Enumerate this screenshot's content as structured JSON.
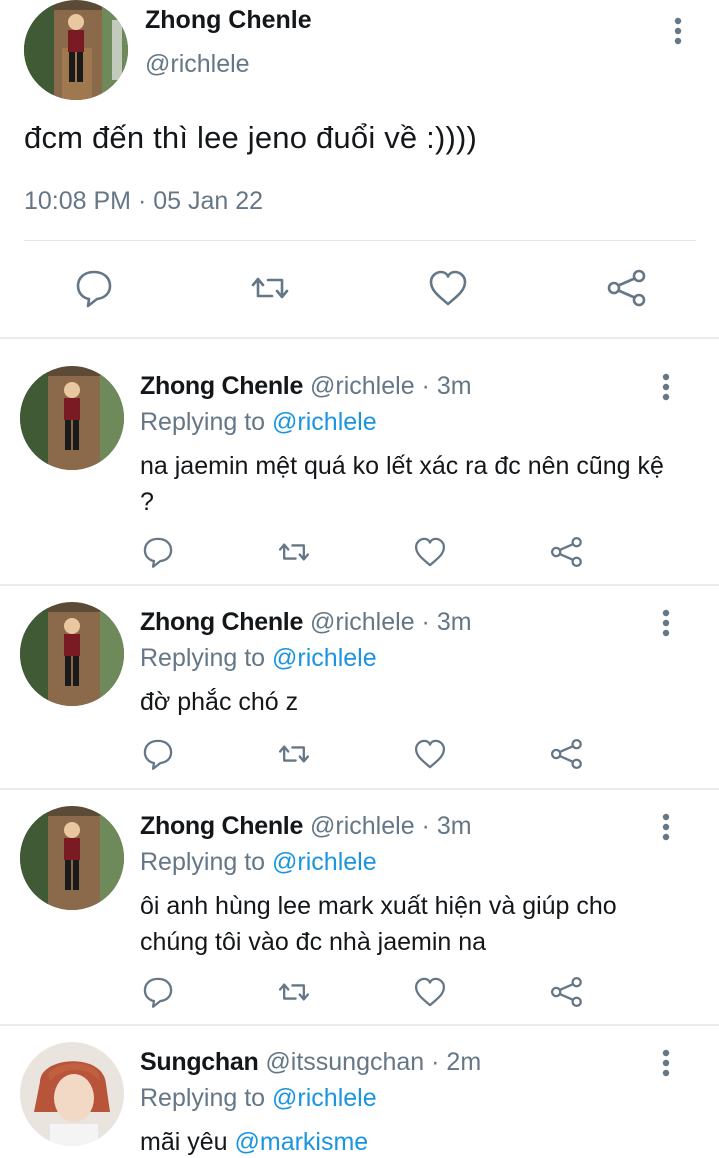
{
  "colors": {
    "link": "#1b95e0",
    "secondary": "#657786",
    "primary_text": "#14171a",
    "divider": "#e6ecf0"
  },
  "icons": {
    "reply": "reply-icon",
    "retweet": "retweet-icon",
    "like": "heart-icon",
    "share": "share-icon",
    "more": "more-vertical-icon"
  },
  "main_tweet": {
    "name": "Zhong Chenle",
    "handle": "@richlele",
    "text": "đcm đến thì lee jeno đuổi về :))))",
    "timestamp": "10:08 PM · 05 Jan 22"
  },
  "replies": [
    {
      "name": "Zhong Chenle",
      "handle": "@richlele",
      "sep": " · ",
      "time": "3m",
      "replying_label": "Replying to",
      "replying_to": "@richlele",
      "text": "na jaemin mệt quá ko lết xác ra đc nên cũng kệ ?"
    },
    {
      "name": "Zhong Chenle",
      "handle": "@richlele",
      "sep": " · ",
      "time": "3m",
      "replying_label": "Replying to",
      "replying_to": "@richlele",
      "text": "đờ phắc chó z"
    },
    {
      "name": "Zhong Chenle",
      "handle": "@richlele",
      "sep": " · ",
      "time": "3m",
      "replying_label": "Replying to",
      "replying_to": "@richlele",
      "text": "ôi anh hùng lee mark xuất hiện và giúp cho chúng tôi vào đc nhà jaemin na"
    },
    {
      "name": "Sungchan",
      "handle": "@itssungchan",
      "sep": " · ",
      "time": "2m",
      "replying_label": "Replying to",
      "replying_to": "@richlele",
      "text_prefix": "mãi yêu ",
      "text_mention": "@markisme"
    }
  ]
}
